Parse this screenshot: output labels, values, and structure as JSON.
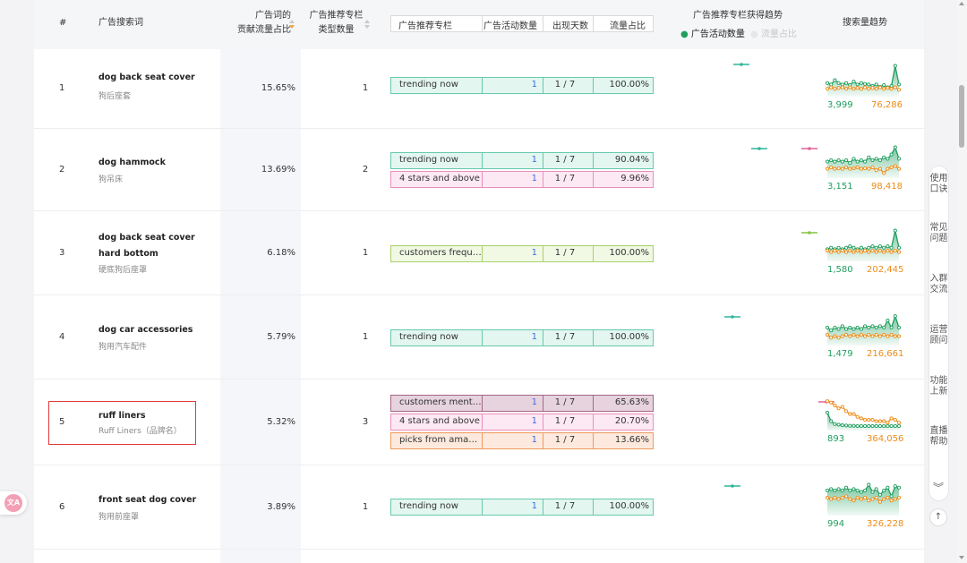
{
  "header": {
    "idx": "#",
    "keyword": "广告搜索词",
    "share_l1": "广告词的",
    "share_l2": "贡献流量占比",
    "type_l1": "广告推荐专栏",
    "type_l2": "类型数量",
    "box_col1": "广告推荐专栏",
    "box_col2": "广告活动数量",
    "box_col3": "出现天数",
    "box_col4": "流量占比",
    "trend_title": "广告推荐专栏获得趋势",
    "legend_active": "广告活动数量",
    "legend_inactive": "流量占比",
    "search_trend": "搜索量趋势"
  },
  "colors": {
    "green": "#1f9e5e",
    "orange": "#ee8b16",
    "teal": "#2fb59a",
    "pink": "#e2619c",
    "lime": "#86c440",
    "red_box": "#e23a3a"
  },
  "rows": [
    {
      "idx": "1",
      "kw": "dog back seat cover",
      "cn": "狗后座套",
      "share": "15.65%",
      "count": "1",
      "badges": [
        {
          "name": "trending now",
          "ads": "1",
          "days": "1 / 7",
          "pct": "100.00%",
          "style": "green"
        }
      ],
      "sv_green": "3,999",
      "sv_orange": "76,286"
    },
    {
      "idx": "2",
      "kw": "dog hammock",
      "cn": "狗吊床",
      "share": "13.69%",
      "count": "2",
      "badges": [
        {
          "name": "trending now",
          "ads": "1",
          "days": "1 / 7",
          "pct": "90.04%",
          "style": "green"
        },
        {
          "name": "4 stars and above",
          "ads": "1",
          "days": "1 / 7",
          "pct": "9.96%",
          "style": "pink"
        }
      ],
      "sv_green": "3,151",
      "sv_orange": "98,418"
    },
    {
      "idx": "3",
      "kw": "dog back seat cover hard bottom",
      "cn": "硬底狗后座罩",
      "share": "6.18%",
      "count": "1",
      "badges": [
        {
          "name": "customers frequently viewed",
          "ads": "1",
          "days": "1 / 7",
          "pct": "100.00%",
          "style": "lime"
        }
      ],
      "sv_green": "1,580",
      "sv_orange": "202,445"
    },
    {
      "idx": "4",
      "kw": "dog car accessories",
      "cn": "狗用汽车配件",
      "share": "5.79%",
      "count": "1",
      "badges": [
        {
          "name": "trending now",
          "ads": "1",
          "days": "1 / 7",
          "pct": "100.00%",
          "style": "green"
        }
      ],
      "sv_green": "1,479",
      "sv_orange": "216,661"
    },
    {
      "idx": "5",
      "kw": "ruff liners",
      "cn": "Ruff Liners（品牌名）",
      "share": "5.32%",
      "count": "3",
      "badges": [
        {
          "name": "customers mentioned",
          "ads": "1",
          "days": "1 / 7",
          "pct": "65.63%",
          "style": "mauve"
        },
        {
          "name": "4 stars and above",
          "ads": "1",
          "days": "1 / 7",
          "pct": "20.70%",
          "style": "pink"
        },
        {
          "name": "picks from amazon",
          "ads": "1",
          "days": "1 / 7",
          "pct": "13.66%",
          "style": "orange"
        }
      ],
      "sv_green": "893",
      "sv_orange": "364,056"
    },
    {
      "idx": "6",
      "kw": "front seat dog cover",
      "cn": "狗用前座罩",
      "share": "3.89%",
      "count": "1",
      "badges": [
        {
          "name": "trending now",
          "ads": "1",
          "days": "1 / 7",
          "pct": "100.00%",
          "style": "green"
        }
      ],
      "sv_green": "994",
      "sv_orange": "326,228"
    }
  ],
  "sidebar": {
    "items": [
      "使用口诀",
      "常见问题",
      "入群交流",
      "运营顾问",
      "功能上新",
      "直播帮助"
    ],
    "collapse_icon": "chevron-double-down-icon",
    "top_icon": "back-to-top-icon",
    "translate_icon": "translate-icon"
  }
}
